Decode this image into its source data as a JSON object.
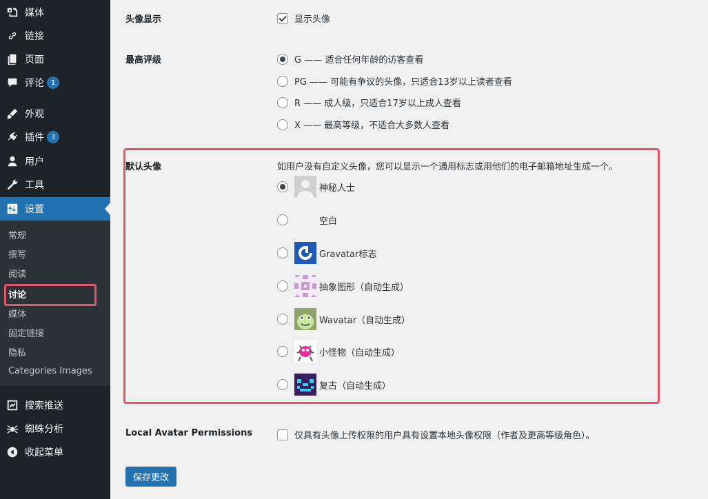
{
  "sidebar": {
    "top_items": [
      {
        "label": "媒体",
        "icon": "media-icon"
      },
      {
        "label": "链接",
        "icon": "link-icon"
      },
      {
        "label": "页面",
        "icon": "pages-icon"
      },
      {
        "label": "评论",
        "icon": "comments-icon",
        "badge": "1"
      },
      {
        "label": "外观",
        "icon": "appearance-icon"
      },
      {
        "label": "插件",
        "icon": "plugins-icon",
        "badge": "3"
      },
      {
        "label": "用户",
        "icon": "users-icon"
      },
      {
        "label": "工具",
        "icon": "tools-icon"
      },
      {
        "label": "设置",
        "icon": "settings-icon"
      }
    ],
    "sub_items": [
      "常规",
      "撰写",
      "阅读",
      "讨论",
      "媒体",
      "固定链接",
      "隐私",
      "Categories Images"
    ],
    "bottom_items": [
      {
        "label": "搜索推送",
        "icon": "search-push-icon"
      },
      {
        "label": "蜘蛛分析",
        "icon": "spider-icon"
      },
      {
        "label": "收起菜单",
        "icon": "collapse-icon"
      }
    ]
  },
  "avatar_display": {
    "label": "头像显示",
    "checkbox_label": "显示头像",
    "checked": true
  },
  "max_rating": {
    "label": "最高评级",
    "options": [
      "G —— 适合任何年龄的访客查看",
      "PG —— 可能有争议的头像，只适合13岁以上读者查看",
      "R —— 成人级，只适合17岁以上成人查看",
      "X —— 最高等级，不适合大多数人查看"
    ],
    "selected_index": 0
  },
  "default_avatar": {
    "label": "默认头像",
    "description": "如用户没有自定义头像，您可以显示一个通用标志或用他们的电子邮箱地址生成一个。",
    "options": [
      {
        "label": "神秘人士",
        "icon": "mystery-person-avatar-icon"
      },
      {
        "label": "空白",
        "icon": "blank-avatar-icon"
      },
      {
        "label": "Gravatar标志",
        "icon": "gravatar-logo-icon"
      },
      {
        "label": "抽象图形（自动生成）",
        "icon": "identicon-avatar-icon"
      },
      {
        "label": "Wavatar（自动生成）",
        "icon": "wavatar-avatar-icon"
      },
      {
        "label": "小怪物（自动生成）",
        "icon": "monsterid-avatar-icon"
      },
      {
        "label": "复古（自动生成）",
        "icon": "retro-avatar-icon"
      }
    ],
    "selected_index": 0
  },
  "local_avatar": {
    "label": "Local Avatar Permissions",
    "checkbox_label": "仅具有头像上传权限的用户具有设置本地头像权限（作者及更高等级角色）。",
    "checked": false
  },
  "save_button": "保存更改",
  "colors": {
    "sidebar_bg": "#1d2327",
    "accent": "#2271b1",
    "highlight": "#e0576b",
    "content_bg": "#f0f0f1"
  }
}
